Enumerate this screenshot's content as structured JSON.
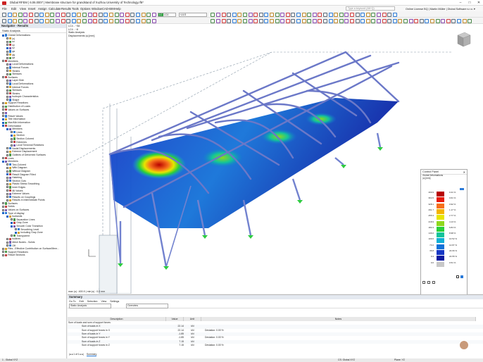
{
  "window": {
    "title": "Dlubal RFEM | 6.06.0007 | Membrane structure for grandstand of Xuzhou University of Technology.rf6*",
    "minimize": "–",
    "maximize": "□",
    "close": "✕"
  },
  "menu": [
    "File",
    "Edit",
    "View",
    "Insert",
    "Assign",
    "Calculate",
    "Results",
    "Tools",
    "Options",
    "Window",
    "CAD-BIM",
    "Help"
  ],
  "search_placeholder": "Type a keyword (Alt+Q)",
  "license": "Online License BQ | Martin Müller | Dlubal Software s.r.o. ▾",
  "toolbar": {
    "load_case": "LC4",
    "combo": "~ULS"
  },
  "navigator": {
    "title": "Navigator - Results",
    "dropdown": "Static Analysis",
    "items": [
      {
        "label": "Global Deformations",
        "lvl": 0,
        "cb": true
      },
      {
        "label": "|u|",
        "lvl": 1,
        "cb": false
      },
      {
        "label": "ux",
        "lvl": 1,
        "cb": false
      },
      {
        "label": "uy",
        "lvl": 1,
        "cb": false
      },
      {
        "label": "uz",
        "lvl": 1,
        "cb": true
      },
      {
        "label": "φx",
        "lvl": 1,
        "cb": false
      },
      {
        "label": "φy",
        "lvl": 1,
        "cb": false
      },
      {
        "label": "φz",
        "lvl": 1,
        "cb": false
      },
      {
        "label": "Members",
        "lvl": 0,
        "cb": false
      },
      {
        "label": "Local Deformations",
        "lvl": 1,
        "cb": false
      },
      {
        "label": "Internal Forces",
        "lvl": 1,
        "cb": false
      },
      {
        "label": "Strains",
        "lvl": 1,
        "cb": false
      },
      {
        "label": "Stresses",
        "lvl": 1,
        "cb": false
      },
      {
        "label": "Surfaces",
        "lvl": 0,
        "cb": false
      },
      {
        "label": "Layer Side",
        "lvl": 1,
        "cb": false
      },
      {
        "label": "Local Deformations",
        "lvl": 1,
        "cb": false
      },
      {
        "label": "Internal Forces",
        "lvl": 1,
        "cb": false
      },
      {
        "label": "Stresses",
        "lvl": 1,
        "cb": false
      },
      {
        "label": "Strains",
        "lvl": 1,
        "cb": false
      },
      {
        "label": "Isotropic Characteristics",
        "lvl": 1,
        "cb": false
      },
      {
        "label": "Shape",
        "lvl": 1,
        "cb": false
      },
      {
        "label": "Support Reactions",
        "lvl": 0,
        "cb": false
      },
      {
        "label": "Distribution of Loads",
        "lvl": 0,
        "cb": false
      },
      {
        "label": "Values on Surfaces",
        "lvl": 0,
        "cb": false
      },
      {
        "label": "",
        "lvl": 0,
        "cb": false
      },
      {
        "label": "Result Values",
        "lvl": 0,
        "cb": false
      },
      {
        "label": "Title Information",
        "lvl": 0,
        "cb": true
      },
      {
        "label": "Max/Min Information",
        "lvl": 0,
        "cb": true
      },
      {
        "label": "Deformation",
        "lvl": 0,
        "cb": true
      },
      {
        "label": "Members",
        "lvl": 1,
        "cb": true
      },
      {
        "label": "Lines",
        "lvl": 2,
        "cb": false
      },
      {
        "label": "Section",
        "lvl": 2,
        "cb": true
      },
      {
        "label": "Section Colored",
        "lvl": 2,
        "cb": false
      },
      {
        "label": "Extremes",
        "lvl": 2,
        "cb": false
      },
      {
        "label": "Local Torsional Rotations",
        "lvl": 2,
        "cb": false
      },
      {
        "label": "Nodal Displacements",
        "lvl": 1,
        "cb": false
      },
      {
        "label": "Extreme Displacement",
        "lvl": 1,
        "cb": false
      },
      {
        "label": "Outlines of Deformed Surfaces",
        "lvl": 1,
        "cb": false
      },
      {
        "label": "Lines",
        "lvl": 0,
        "cb": false
      },
      {
        "label": "Members",
        "lvl": 0,
        "cb": true
      },
      {
        "label": "Two-Colored",
        "lvl": 1,
        "cb": false
      },
      {
        "label": "With Diagram",
        "lvl": 1,
        "cb": false
      },
      {
        "label": "Without Diagram",
        "lvl": 1,
        "cb": false
      },
      {
        "label": "Result Diagram Filled",
        "lvl": 1,
        "cb": true
      },
      {
        "label": "Hatching",
        "lvl": 1,
        "cb": false
      },
      {
        "label": "Section Cuts",
        "lvl": 1,
        "cb": false
      },
      {
        "label": "Plastic Stress Smoothing",
        "lvl": 1,
        "cb": false
      },
      {
        "label": "Inner Edges",
        "lvl": 1,
        "cb": false
      },
      {
        "label": "All Values",
        "lvl": 1,
        "cb": false
      },
      {
        "label": "Extreme Values",
        "lvl": 1,
        "cb": false
      },
      {
        "label": "Results on Couplings",
        "lvl": 1,
        "cb": false
      },
      {
        "label": "Results in Intermediate Points",
        "lvl": 1,
        "cb": false
      },
      {
        "label": "Surfaces",
        "lvl": 0,
        "cb": false
      },
      {
        "label": "Solids",
        "lvl": 0,
        "cb": false
      },
      {
        "label": "Values on Surfaces",
        "lvl": 0,
        "cb": false
      },
      {
        "label": "Type of display",
        "lvl": 0,
        "cb": true
      },
      {
        "label": "Isobands",
        "lvl": 1,
        "cb": true
      },
      {
        "label": "Separation Lines",
        "lvl": 2,
        "cb": false
      },
      {
        "label": "Gray Zone",
        "lvl": 2,
        "cb": true
      },
      {
        "label": "Smooth Color Transition",
        "lvl": 2,
        "cb": true
      },
      {
        "label": "Smoothing Level",
        "lvl": 3,
        "cb": false
      },
      {
        "label": "Including Gray Zone",
        "lvl": 3,
        "cb": true
      },
      {
        "label": "Transparent",
        "lvl": 2,
        "cb": false
      },
      {
        "label": "Isolines",
        "lvl": 1,
        "cb": false
      },
      {
        "label": "Mesh Nodes - Solids",
        "lvl": 1,
        "cb": false
      },
      {
        "label": "Off",
        "lvl": 1,
        "cb": false
      },
      {
        "label": "Ribs - Effective Contribution on Surface/Mem...",
        "lvl": 0,
        "cb": false
      },
      {
        "label": "Support Reactions",
        "lvl": 0,
        "cb": false
      },
      {
        "label": "Result Sections",
        "lvl": 0,
        "cb": false
      }
    ]
  },
  "viewport": {
    "info_lines": [
      "LC4 - ~S8",
      "LC4 - ~8",
      "Static Analysis",
      "Displacements |u| [mm]"
    ],
    "max_label": "max |u| : 400.9 | min |u| : 0.0 mm"
  },
  "control_panel": {
    "title": "Control Panel",
    "sub1": "Global Deformations",
    "sub2": "|u| [mm]",
    "legend": [
      {
        "value": "400.9",
        "color": "#b80000",
        "pct": "0.41 %"
      },
      {
        "value": "364.5",
        "color": "#e81b0e",
        "pct": "0.61 %"
      },
      {
        "value": "328.1",
        "color": "#f7701c",
        "pct": "0.92 %"
      },
      {
        "value": "291.7",
        "color": "#f4b400",
        "pct": "1.17 %"
      },
      {
        "value": "255.3",
        "color": "#e8e500",
        "pct": "2.77 %"
      },
      {
        "value": "218.9",
        "color": "#8fd81d",
        "pct": "4.13 %"
      },
      {
        "value": "182.4",
        "color": "#2ad03a",
        "pct": "6.84 %"
      },
      {
        "value": "146.0",
        "color": "#12c49a",
        "pct": "8.98 %"
      },
      {
        "value": "109.6",
        "color": "#12b0d6",
        "pct": "10.52 %"
      },
      {
        "value": "73.2",
        "color": "#1372d8",
        "pct": "14.87 %"
      },
      {
        "value": "36.8",
        "color": "#1638c5",
        "pct": "24.66 %"
      },
      {
        "value": "0.4",
        "color": "#0b1aa0",
        "pct": "22.55 %"
      },
      {
        "value": "0.0",
        "color": "#c8c8c8",
        "pct": "0.51 %"
      }
    ]
  },
  "summary": {
    "title": "Summary",
    "menu": [
      "Go To",
      "Edit",
      "Selection",
      "View",
      "Settings"
    ],
    "analysis": "Static Analysis",
    "view": "Overview",
    "pager": "1 of 1",
    "tab": "Summary",
    "headers": [
      "Description",
      "Value",
      "Unit",
      "Notes"
    ],
    "group": "Sum of loads and sum of support forces",
    "rows": [
      {
        "d": "Sum of loads in X",
        "v": "22.14",
        "u": "kN",
        "n": ""
      },
      {
        "d": "Sum of support forces in X",
        "v": "22.14",
        "u": "kN",
        "n": "Deviation: 0.00 %"
      },
      {
        "d": "Sum of loads in Y",
        "v": "-1.85",
        "u": "kN",
        "n": ""
      },
      {
        "d": "Sum of support forces in Y",
        "v": "-1.85",
        "u": "kN",
        "n": "Deviation: 0.00 %"
      },
      {
        "d": "Sum of loads in Z",
        "v": "7.15",
        "u": "kN",
        "n": ""
      },
      {
        "d": "Sum of support forces in Z",
        "v": "7.15",
        "u": "kN",
        "n": "Deviation: 0.00 %"
      }
    ]
  },
  "statusbar": {
    "left": "1 - Global XYZ",
    "mid": "CS: Global XYZ",
    "right": "Plane: YZ"
  }
}
